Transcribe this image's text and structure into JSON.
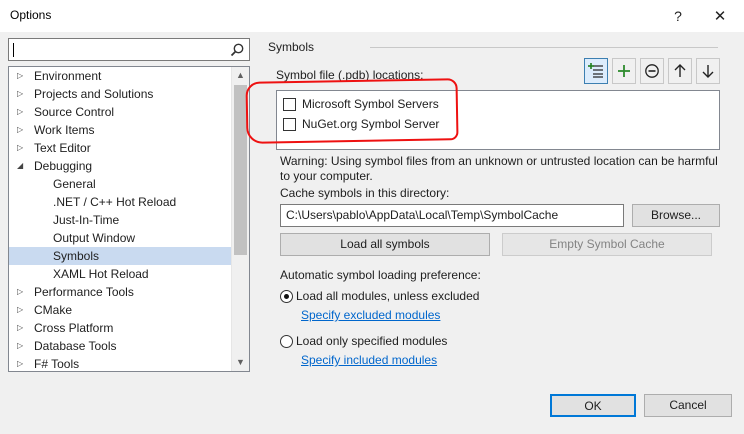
{
  "window": {
    "title": "Options",
    "help_glyph": "?",
    "close_glyph": "✕"
  },
  "search": {
    "placeholder": "",
    "value": ""
  },
  "tree": {
    "items": [
      {
        "label": "Environment",
        "expander": "collapsed",
        "level": 0
      },
      {
        "label": "Projects and Solutions",
        "expander": "collapsed",
        "level": 0
      },
      {
        "label": "Source Control",
        "expander": "collapsed",
        "level": 0
      },
      {
        "label": "Work Items",
        "expander": "collapsed",
        "level": 0
      },
      {
        "label": "Text Editor",
        "expander": "collapsed",
        "level": 0
      },
      {
        "label": "Debugging",
        "expander": "expanded",
        "level": 0
      },
      {
        "label": "General",
        "expander": "none",
        "level": 1
      },
      {
        "label": ".NET / C++ Hot Reload",
        "expander": "none",
        "level": 1
      },
      {
        "label": "Just-In-Time",
        "expander": "none",
        "level": 1
      },
      {
        "label": "Output Window",
        "expander": "none",
        "level": 1
      },
      {
        "label": "Symbols",
        "expander": "none",
        "level": 1,
        "selected": true
      },
      {
        "label": "XAML Hot Reload",
        "expander": "none",
        "level": 1
      },
      {
        "label": "Performance Tools",
        "expander": "collapsed",
        "level": 0
      },
      {
        "label": "CMake",
        "expander": "collapsed",
        "level": 0
      },
      {
        "label": "Cross Platform",
        "expander": "collapsed",
        "level": 0
      },
      {
        "label": "Database Tools",
        "expander": "collapsed",
        "level": 0
      },
      {
        "label": "F# Tools",
        "expander": "collapsed",
        "level": 0
      }
    ]
  },
  "symbols": {
    "section_title": "Symbols",
    "locations_label": "Symbol file (.pdb) locations:",
    "toolbar_icons": [
      "add-location-icon",
      "plus-icon",
      "minus-circle-icon",
      "arrow-up-icon",
      "arrow-down-icon"
    ],
    "locations": [
      {
        "label": "Microsoft Symbol Servers",
        "checked": false
      },
      {
        "label": "NuGet.org Symbol Server",
        "checked": false
      }
    ],
    "warning": "Warning: Using symbol files from an unknown or untrusted location can be harmful to your computer.",
    "cache_label": "Cache symbols in this directory:",
    "cache_path": "C:\\Users\\pablo\\AppData\\Local\\Temp\\SymbolCache",
    "browse_label": "Browse...",
    "load_all_label": "Load all symbols",
    "empty_cache_label": "Empty Symbol Cache",
    "preference_label": "Automatic symbol loading preference:",
    "option_all": "Load all modules, unless excluded",
    "link_excluded": "Specify excluded modules",
    "option_specified": "Load only specified modules",
    "link_included": "Specify included modules",
    "selected_option": "all"
  },
  "footer": {
    "ok_label": "OK",
    "cancel_label": "Cancel"
  },
  "colors": {
    "annotation": "#ee1111",
    "link": "#0066cc",
    "selection": "#c9daf0",
    "accent": "#0078d7"
  }
}
